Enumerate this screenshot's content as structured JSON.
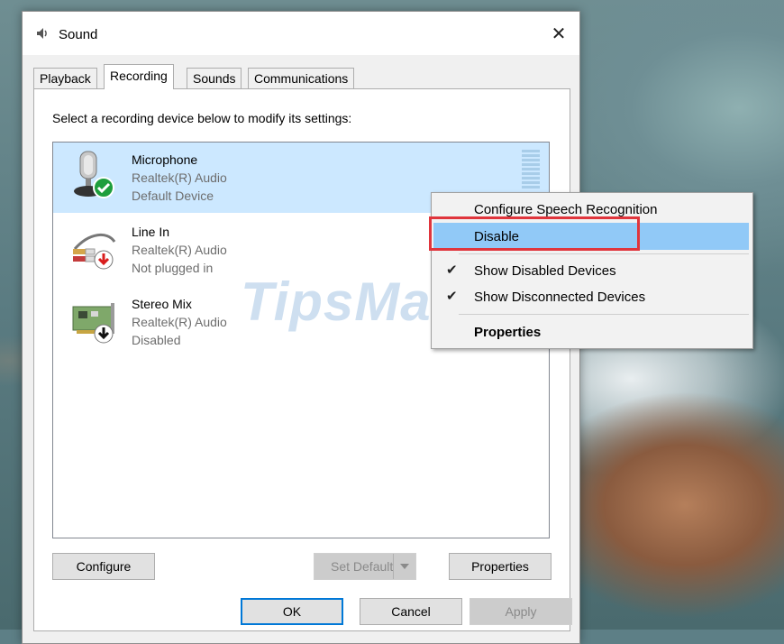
{
  "window": {
    "title": "Sound",
    "close_glyph": "✕"
  },
  "tabs": [
    {
      "label": "Playback",
      "active": false
    },
    {
      "label": "Recording",
      "active": true
    },
    {
      "label": "Sounds",
      "active": false
    },
    {
      "label": "Communications",
      "active": false
    }
  ],
  "instruction": "Select a recording device below to modify its settings:",
  "devices": [
    {
      "name": "Microphone",
      "driver": "Realtek(R) Audio",
      "status": "Default Device",
      "icon": "microphone-icon",
      "badge": "green-check-badge",
      "selected": true
    },
    {
      "name": "Line In",
      "driver": "Realtek(R) Audio",
      "status": "Not plugged in",
      "icon": "line-in-jack-icon",
      "badge": "red-down-arrow-badge",
      "selected": false
    },
    {
      "name": "Stereo Mix",
      "driver": "Realtek(R) Audio",
      "status": "Disabled",
      "icon": "sound-card-icon",
      "badge": "black-down-arrow-badge",
      "selected": false
    }
  ],
  "watermark": "TipsMake",
  "buttons": {
    "configure": "Configure",
    "set_default": "Set Default",
    "properties": "Properties",
    "ok": "OK",
    "cancel": "Cancel",
    "apply": "Apply"
  },
  "context_menu": {
    "items": [
      {
        "label": "Configure Speech Recognition",
        "checked": false,
        "highlighted": false,
        "bold": false
      },
      {
        "label": "Disable",
        "checked": false,
        "highlighted": true,
        "bold": false
      },
      {
        "label": "Show Disabled Devices",
        "checked": true,
        "highlighted": false,
        "bold": false
      },
      {
        "label": "Show Disconnected Devices",
        "checked": true,
        "highlighted": false,
        "bold": false
      },
      {
        "label": "Properties",
        "checked": false,
        "highlighted": false,
        "bold": true
      }
    ],
    "check_glyph": "✔"
  },
  "colors": {
    "accent": "#0078d7",
    "selection": "#cce8ff",
    "menu_highlight": "#91c9f7",
    "annotation_red": "#e0353c"
  }
}
